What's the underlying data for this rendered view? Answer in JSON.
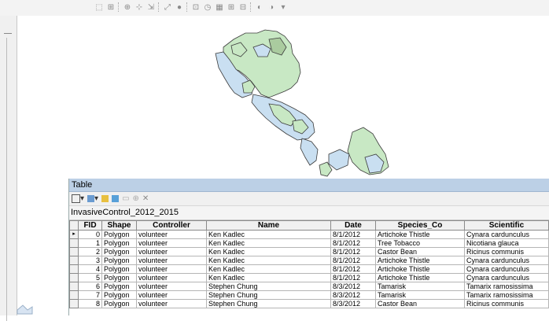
{
  "window": {
    "close_glyph": "×"
  },
  "toolbar": {
    "icons": [
      "select-icon",
      "identify-icon",
      "find-icon",
      "measure-icon",
      "pan-icon",
      "zoom-icon",
      "globe-icon",
      "layout-icon",
      "time-icon",
      "table-icon",
      "html-icon",
      "overflow-icon"
    ]
  },
  "map": {
    "polygon_fill": "#c8e8c4",
    "polygon_blue": "#c9dff1",
    "outline": "#3c3c3c"
  },
  "table_window": {
    "title": "Table",
    "layer_name": "InvasiveControl_2012_2015",
    "columns": [
      "",
      "FID",
      "Shape",
      "Controller",
      "Name",
      "Date",
      "Species_Co",
      "Scientific"
    ],
    "rows": [
      {
        "fid": "0",
        "shape": "Polygon",
        "controller": "volunteer",
        "name": "Ken Kadlec",
        "date": "8/1/2012",
        "species": "Artichoke Thistle",
        "scientific": "Cynara cardunculus",
        "current": true
      },
      {
        "fid": "1",
        "shape": "Polygon",
        "controller": "volunteer",
        "name": "Ken Kadlec",
        "date": "8/1/2012",
        "species": "Tree Tobacco",
        "scientific": "Nicotiana glauca",
        "current": false
      },
      {
        "fid": "2",
        "shape": "Polygon",
        "controller": "volunteer",
        "name": "Ken Kadlec",
        "date": "8/1/2012",
        "species": "Castor Bean",
        "scientific": "Ricinus communis",
        "current": false
      },
      {
        "fid": "3",
        "shape": "Polygon",
        "controller": "volunteer",
        "name": "Ken Kadlec",
        "date": "8/1/2012",
        "species": "Artichoke Thistle",
        "scientific": "Cynara cardunculus",
        "current": false
      },
      {
        "fid": "4",
        "shape": "Polygon",
        "controller": "volunteer",
        "name": "Ken Kadlec",
        "date": "8/1/2012",
        "species": "Artichoke Thistle",
        "scientific": "Cynara cardunculus",
        "current": false
      },
      {
        "fid": "5",
        "shape": "Polygon",
        "controller": "volunteer",
        "name": "Ken Kadlec",
        "date": "8/1/2012",
        "species": "Artichoke Thistle",
        "scientific": "Cynara cardunculus",
        "current": false
      },
      {
        "fid": "6",
        "shape": "Polygon",
        "controller": "volunteer",
        "name": "Stephen Chung",
        "date": "8/3/2012",
        "species": "Tamarisk",
        "scientific": "Tamarix ramosissima",
        "current": false
      },
      {
        "fid": "7",
        "shape": "Polygon",
        "controller": "volunteer",
        "name": "Stephen Chung",
        "date": "8/3/2012",
        "species": "Tamarisk",
        "scientific": "Tamarix ramosissima",
        "current": false
      },
      {
        "fid": "8",
        "shape": "Polygon",
        "controller": "volunteer",
        "name": "Stephen Chung",
        "date": "8/3/2012",
        "species": "Castor Bean",
        "scientific": "Ricinus communis",
        "current": false
      }
    ]
  }
}
